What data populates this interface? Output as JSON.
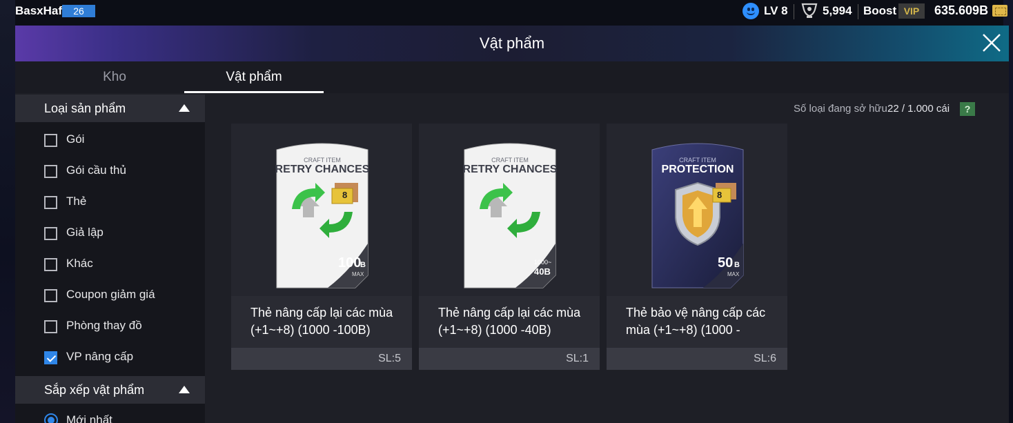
{
  "topbar": {
    "username": "BasxHaf",
    "user_level": "26",
    "lv": "LV 8",
    "coins": "5,994",
    "boost": "Boost",
    "vip": "VIP",
    "balance": "635.609B"
  },
  "dialog": {
    "title": "Vật phẩm",
    "tabs": [
      {
        "label": "Kho",
        "active": false
      },
      {
        "label": "Vật phẩm",
        "active": true
      }
    ]
  },
  "sidebar": {
    "product_type": {
      "title": "Loại sản phẩm",
      "items": [
        {
          "label": "Gói",
          "checked": false
        },
        {
          "label": "Gói cầu thủ",
          "checked": false
        },
        {
          "label": "Thẻ",
          "checked": false
        },
        {
          "label": "Giả lập",
          "checked": false
        },
        {
          "label": "Khác",
          "checked": false
        },
        {
          "label": "Coupon giảm giá",
          "checked": false
        },
        {
          "label": "Phòng thay đồ",
          "checked": false
        },
        {
          "label": "VP nâng cấp",
          "checked": true
        }
      ]
    },
    "sort": {
      "title": "Sắp xếp vật phẩm",
      "selected_option": "Mới nhất"
    }
  },
  "content": {
    "owned_label": "Số loại đang sở hữu",
    "owned_count": "22 / 1.000 cái",
    "help": "?",
    "items": [
      {
        "craft_label": "CRAFT ITEM",
        "craft_title": "RETRY CHANCES",
        "level_badge": "8",
        "price_main": "100",
        "price_unit": "B",
        "price_sub": "MAX",
        "name": "Thẻ nâng cấp lại các mùa (+1~+8) (1000 -100B)",
        "qty": "SL:5"
      },
      {
        "craft_label": "CRAFT ITEM",
        "craft_title": "RETRY CHANCES",
        "level_badge": "",
        "price_prefix": "1000~",
        "price_main": "40B",
        "name": "Thẻ nâng cấp lại các mùa (+1~+8) (1000 -40B)",
        "qty": "SL:1"
      },
      {
        "craft_label": "CRAFT ITEM",
        "craft_title": "PROTECTION",
        "level_badge": "8",
        "price_main": "50",
        "price_unit": "B",
        "price_sub": "MAX",
        "name": "Thẻ bảo vệ nâng cấp các mùa (+1~+8) (1000 -",
        "qty": "SL:6"
      }
    ]
  },
  "colors": {
    "accent_blue": "#2f86e8",
    "dialog_bg": "#1e1f26",
    "sidebar_bg": "#15161c",
    "vip_gold": "#d4b64a"
  }
}
